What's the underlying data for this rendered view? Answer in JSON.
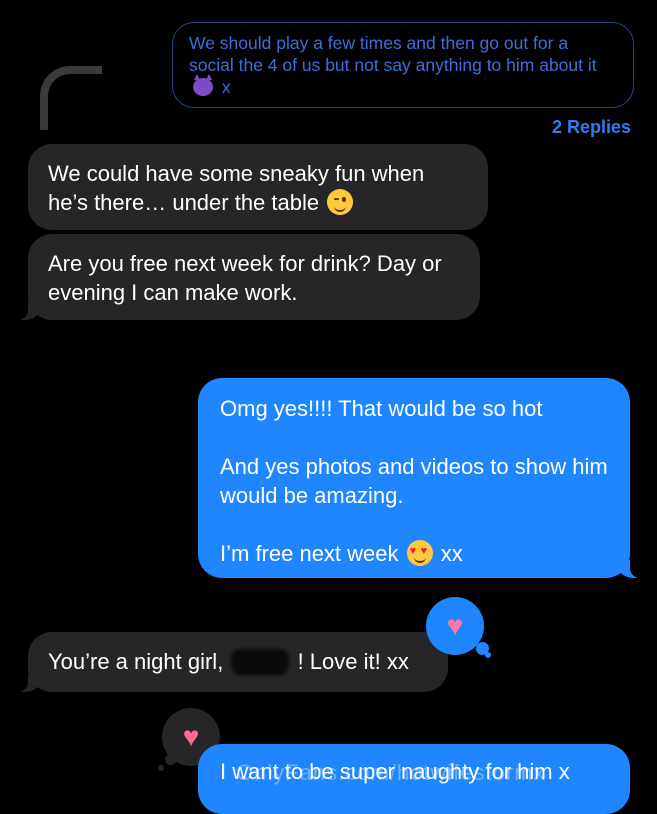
{
  "quoted_message": {
    "text_before": "We should play a few times and then go out for a social the 4 of us but not say anything to him about it",
    "text_after": "x",
    "emoji": "smiling-devil"
  },
  "thread": {
    "replies_label": "2 Replies"
  },
  "messages": [
    {
      "side": "received",
      "text": "We could have some sneaky fun when he’s there… under the table",
      "emoji": "winking-face"
    },
    {
      "side": "received",
      "text": "Are you free next week for drink? Day or evening I can make work."
    },
    {
      "side": "sent",
      "line1": "Omg yes!!!! That would be so hot",
      "line2": "And yes photos and videos to show him would be amazing.",
      "line3_before": "I’m free next week",
      "line3_after": "xx",
      "emoji": "heart-eyes"
    },
    {
      "side": "received",
      "text_before": "You’re a night girl,",
      "text_after": "! Love it! xx",
      "reaction": "heart"
    },
    {
      "side": "sent",
      "text": "I want to be super naughty for him x",
      "reaction": "heart"
    }
  ],
  "watermark": "OnlyFans.com/hotwifestormx",
  "colors": {
    "sent": "#1f86ff",
    "received": "#262628",
    "reply_link": "#2e7cf6",
    "heart": "#ff6b8e"
  }
}
